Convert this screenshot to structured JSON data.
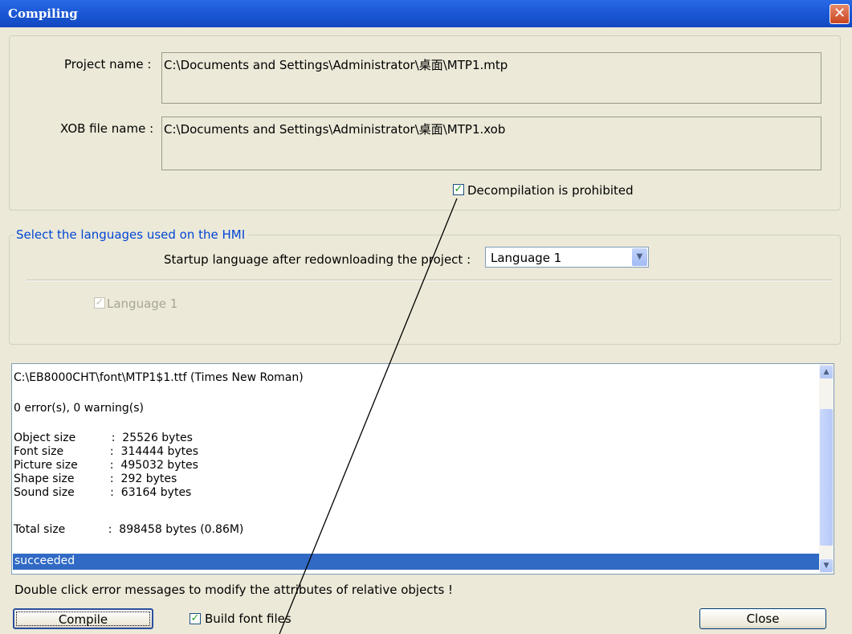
{
  "window": {
    "title": "Compiling",
    "close_glyph": "✕"
  },
  "project": {
    "project_name_label": "Project name :",
    "project_name_value": "C:\\Documents and Settings\\Administrator\\桌面\\MTP1.mtp",
    "xob_label": "XOB file name :",
    "xob_value": "C:\\Documents and Settings\\Administrator\\桌面\\MTP1.xob",
    "decompile_label": "Decompilation is prohibited",
    "decompile_checked": true
  },
  "languages": {
    "group_title": "Select the languages used on the HMI",
    "startup_label": "Startup language after redownloading the project :",
    "startup_value": "Language 1",
    "language1_label": "Language 1"
  },
  "log": {
    "lines": [
      "C:\\EB8000CHT\\font\\MTP1$1.ttf (Times New Roman)",
      "0 error(s), 0 warning(s)",
      "Object size          :  25526 bytes",
      "Font size             :  314444 bytes",
      "Picture size         :  495032 bytes",
      "Shape size          :  292 bytes",
      "Sound size          :  63164 bytes",
      "Total size            :  898458 bytes (0.86M)"
    ],
    "selected": "succeeded"
  },
  "footer": {
    "hint": "Double click error messages to modify the attributes of relative objects !",
    "compile_label": "Compile",
    "build_fonts_label": "Build font files",
    "close_label": "Close"
  },
  "icons": {
    "checkbox": "check-icon",
    "dropdown": "chevron-down-icon",
    "scroll_up": "chevron-up-icon",
    "scroll_down": "chevron-down-icon"
  }
}
